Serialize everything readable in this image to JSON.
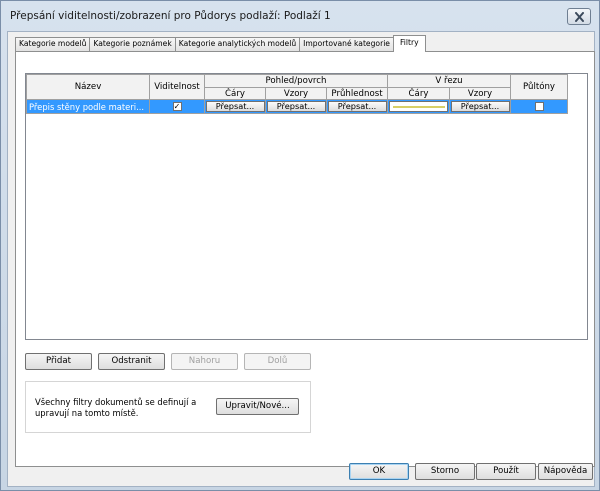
{
  "window": {
    "title": "Přepsání viditelnosti/zobrazení pro Půdorys podlaží: Podlaží 1"
  },
  "tabs": [
    {
      "label": "Kategorie modelů"
    },
    {
      "label": "Kategorie poznámek"
    },
    {
      "label": "Kategorie analytických modelů"
    },
    {
      "label": "Importované kategorie"
    },
    {
      "label": "Filtry"
    }
  ],
  "grid": {
    "headers": {
      "name": "Název",
      "visibility": "Viditelnost",
      "projection_group": "Pohled/povrch",
      "projection_lines": "Čáry",
      "projection_patterns": "Vzory",
      "transparency": "Průhlednost",
      "cut_group": "V řezu",
      "cut_lines": "Čáry",
      "cut_patterns": "Vzory",
      "halftone": "Půltóny"
    },
    "rows": [
      {
        "name": "Přepis stěny podle materi...",
        "visible_mark": "✓",
        "projection_lines": "Přepsat...",
        "projection_patterns": "Přepsat...",
        "transparency": "Přepsat...",
        "cut_patterns": "Přepsat..."
      }
    ]
  },
  "buttons": {
    "add": "Přidat",
    "remove": "Odstranit",
    "up": "Nahoru",
    "down": "Dolů",
    "edit_new": "Upravit/Nové...",
    "ok": "OK",
    "cancel": "Storno",
    "apply": "Použít",
    "help": "Nápověda"
  },
  "note": {
    "text": "Všechny filtry dokumentů se definují a upravují na tomto místě."
  },
  "colors": {
    "selected_row": "#3399ff",
    "cut_line_swatch": "#d8cf67"
  }
}
